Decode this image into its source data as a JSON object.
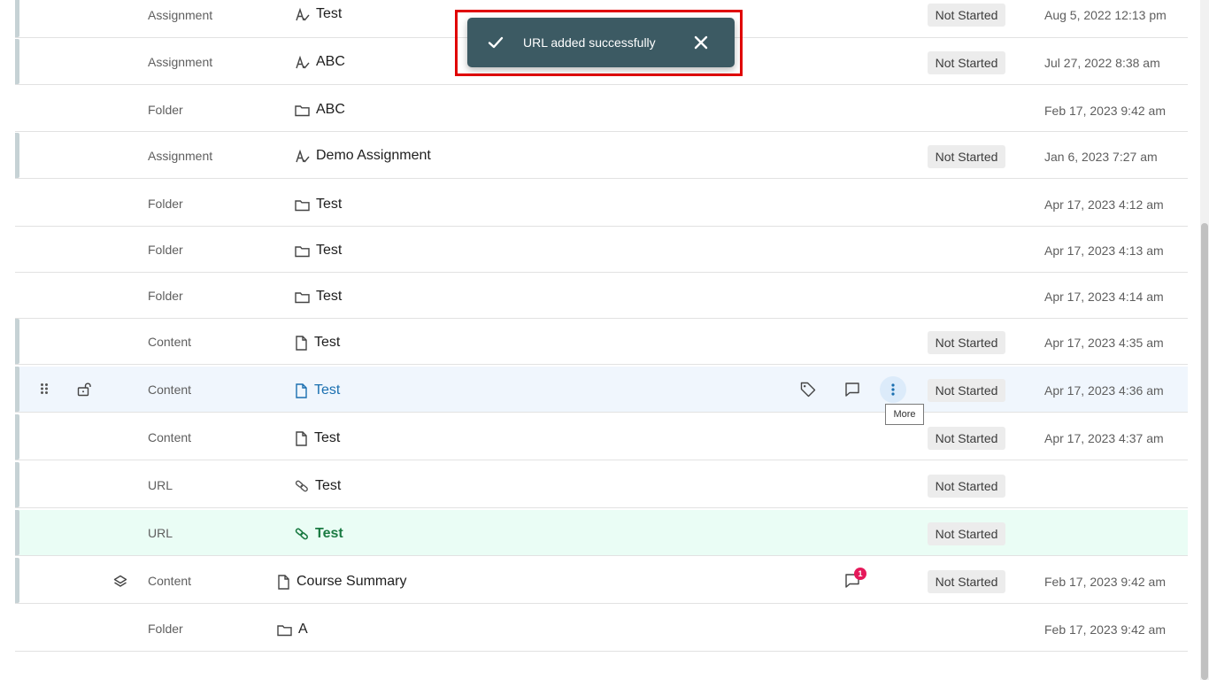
{
  "toast": {
    "message": "URL added successfully",
    "icon": "check-icon",
    "close_icon": "close-icon"
  },
  "rows": [
    {
      "type": "Assignment",
      "title": "Test",
      "icon": "assignment-icon",
      "status": "Not Started",
      "date": "Aug 5, 2022 12:13 pm"
    },
    {
      "type": "Assignment",
      "title": "ABC",
      "icon": "assignment-icon",
      "status": "Not Started",
      "date": "Jul 27, 2022 8:38 am"
    },
    {
      "type": "Folder",
      "title": "ABC",
      "icon": "folder-icon",
      "status": "",
      "date": "Feb 17, 2023 9:42 am"
    },
    {
      "type": "Assignment",
      "title": "Demo Assignment",
      "icon": "assignment-icon",
      "status": "Not Started",
      "date": "Jan 6, 2023 7:27 am"
    },
    {
      "type": "Folder",
      "title": "Test",
      "icon": "folder-icon",
      "status": "",
      "date": "Apr 17, 2023 4:12 am"
    },
    {
      "type": "Folder",
      "title": "Test",
      "icon": "folder-icon",
      "status": "",
      "date": "Apr 17, 2023 4:13 am"
    },
    {
      "type": "Folder",
      "title": "Test",
      "icon": "folder-icon",
      "status": "",
      "date": "Apr 17, 2023 4:14 am"
    },
    {
      "type": "Content",
      "title": "Test",
      "icon": "document-icon",
      "status": "Not Started",
      "date": "Apr 17, 2023 4:35 am"
    },
    {
      "type": "Content",
      "title": "Test",
      "icon": "document-icon",
      "status": "Not Started",
      "date": "Apr 17, 2023 4:36 am"
    },
    {
      "type": "Content",
      "title": "Test",
      "icon": "document-icon",
      "status": "Not Started",
      "date": "Apr 17, 2023 4:37 am"
    },
    {
      "type": "URL",
      "title": "Test",
      "icon": "link-icon",
      "status": "Not Started",
      "date": ""
    },
    {
      "type": "URL",
      "title": "Test",
      "icon": "link-icon",
      "status": "Not Started",
      "date": ""
    },
    {
      "type": "Content",
      "title": "Course Summary",
      "icon": "document-icon",
      "status": "Not Started",
      "date": "Feb 17, 2023 9:42 am"
    },
    {
      "type": "Folder",
      "title": "A",
      "icon": "folder-icon",
      "status": "",
      "date": "Feb 17, 2023 9:42 am"
    }
  ],
  "hover_row": {
    "tooltip": "More",
    "icons": [
      "drag-handle-icon",
      "unlock-icon",
      "tag-icon",
      "comment-icon",
      "more-vertical-icon"
    ]
  },
  "summary_row": {
    "comment_count": "1",
    "icons": [
      "layers-icon",
      "comment-icon"
    ]
  },
  "colors": {
    "toast_bg": "#3c5a63",
    "highlight_border": "#e00000",
    "hover_row_bg": "#f0f6fd",
    "new_row_bg": "#eafdf5",
    "link_blue": "#1a6fb0",
    "new_green": "#1b7b43",
    "badge_red": "#e5195a"
  }
}
